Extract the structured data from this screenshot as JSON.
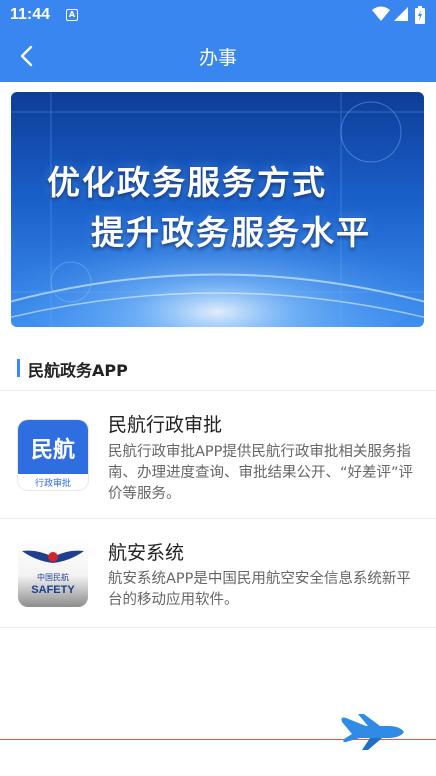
{
  "status_bar": {
    "time": "11:44",
    "notification_badge": "A",
    "icons": [
      "wifi-icon",
      "signal-icon",
      "battery-icon"
    ]
  },
  "app_bar": {
    "title": "办事",
    "back_icon": "chevron-left-icon"
  },
  "banner": {
    "line1": "优化政务服务方式",
    "line2": "提升政务服务水平"
  },
  "section": {
    "title": "民航政务APP"
  },
  "apps": [
    {
      "name": "民航行政审批",
      "description": "民航行政审批APP提供民航行政审批相关服务指南、办理进度查询、审批结果公开、“好差评”评价等服务。",
      "icon_text": "民航",
      "icon_caption": "行政审批"
    },
    {
      "name": "航安系统",
      "description": "航安系统APP是中国民用航空安全信息系统新平台的移动应用软件。",
      "icon_text": "SAFETY",
      "icon_caption": "中国民航"
    }
  ],
  "colors": {
    "primary": "#3a86f0",
    "accent_line": "#e05a4a"
  }
}
